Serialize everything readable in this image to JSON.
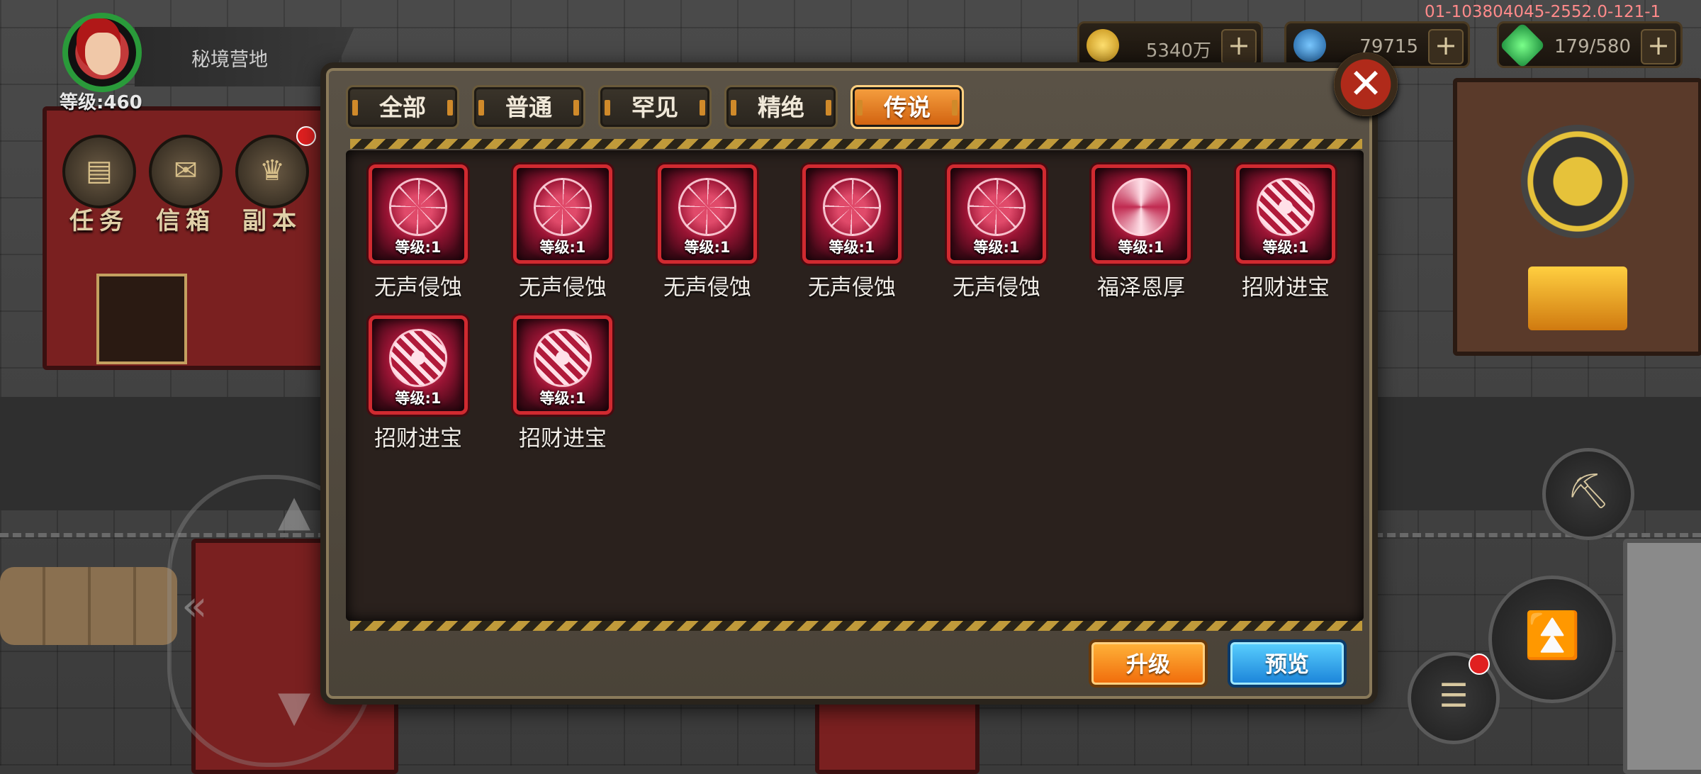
{
  "hud": {
    "player_name": "秘境营地",
    "player_level": "等级:460",
    "side_buttons": [
      {
        "label": "任务",
        "icon": "scroll-icon"
      },
      {
        "label": "信箱",
        "icon": "mailbox-icon"
      },
      {
        "label": "副本",
        "icon": "dungeon-icon"
      }
    ],
    "resources": [
      {
        "name": "gold",
        "icon": "gold-coin-icon",
        "value": "5340万"
      },
      {
        "name": "diamond",
        "icon": "diamond-icon",
        "value": "79715"
      },
      {
        "name": "energy",
        "icon": "green-gem-icon",
        "value": "179/580"
      }
    ],
    "server_id": "01-103804045-2552.0-121-1"
  },
  "dialog": {
    "tabs": [
      {
        "label": "全部",
        "active": false
      },
      {
        "label": "普通",
        "active": false
      },
      {
        "label": "罕见",
        "active": false
      },
      {
        "label": "精绝",
        "active": false
      },
      {
        "label": "传说",
        "active": true
      }
    ],
    "skills": [
      {
        "name": "无声侵蚀",
        "level": "等级:1",
        "icon": "spider-web-icon"
      },
      {
        "name": "无声侵蚀",
        "level": "等级:1",
        "icon": "spider-web-icon"
      },
      {
        "name": "无声侵蚀",
        "level": "等级:1",
        "icon": "spider-web-icon"
      },
      {
        "name": "无声侵蚀",
        "level": "等级:1",
        "icon": "spider-web-icon"
      },
      {
        "name": "无声侵蚀",
        "level": "等级:1",
        "icon": "spider-web-icon"
      },
      {
        "name": "福泽恩厚",
        "level": "等级:1",
        "icon": "swirl-icon"
      },
      {
        "name": "招财进宝",
        "level": "等级:1",
        "icon": "coin-icon"
      },
      {
        "name": "招财进宝",
        "level": "等级:1",
        "icon": "coin-icon"
      },
      {
        "name": "招财进宝",
        "level": "等级:1",
        "icon": "coin-icon"
      }
    ],
    "upgrade_label": "升级",
    "preview_label": "预览",
    "close_icon": "close-icon"
  }
}
